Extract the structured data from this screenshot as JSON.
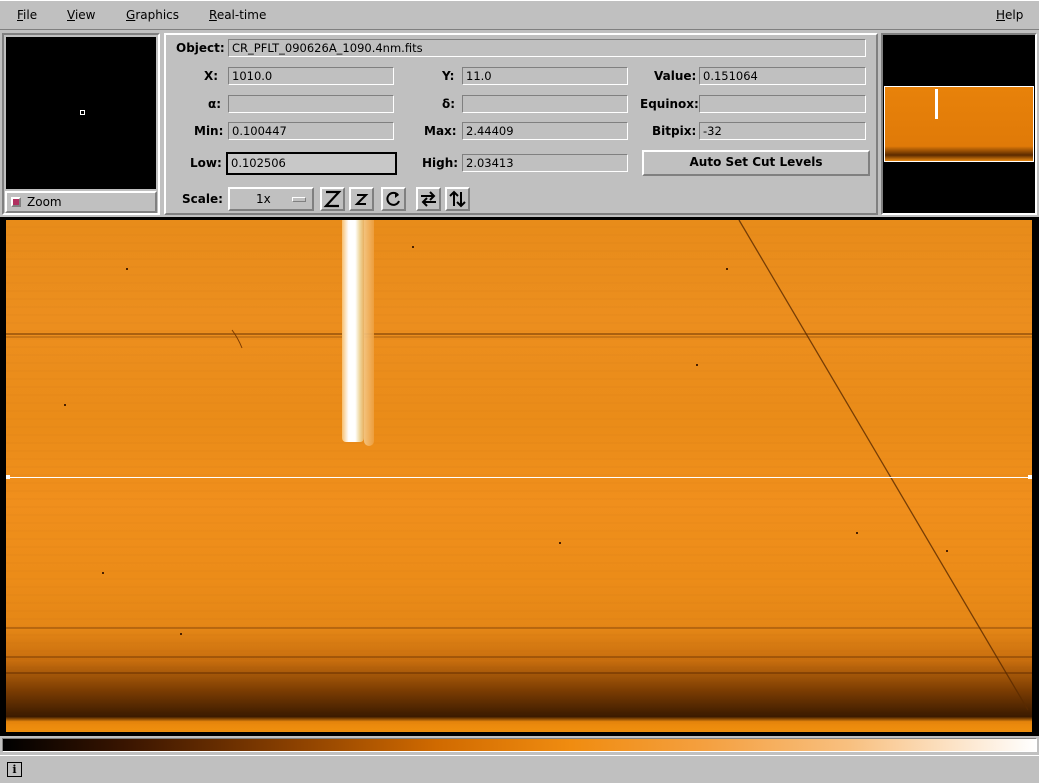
{
  "menubar": {
    "file": "File",
    "view": "View",
    "graphics": "Graphics",
    "realtime": "Real-time",
    "help": "Help"
  },
  "zoom": {
    "label": "Zoom",
    "checked": true
  },
  "info": {
    "object_label": "Object:",
    "object_value": "CR_PFLT_090626A_1090.4nm.fits",
    "x_label": "X:",
    "x_value": "1010.0",
    "y_label": "Y:",
    "y_value": "11.0",
    "value_label": "Value:",
    "value_value": "0.151064",
    "alpha_label": "α:",
    "alpha_value": "",
    "delta_label": "δ:",
    "delta_value": "",
    "equinox_label": "Equinox:",
    "equinox_value": "",
    "min_label": "Min:",
    "min_value": "0.100447",
    "max_label": "Max:",
    "max_value": "2.44409",
    "bitpix_label": "Bitpix:",
    "bitpix_value": "-32",
    "low_label": "Low:",
    "low_value": "0.102506",
    "high_label": "High:",
    "high_value": "2.03413",
    "auto_cut_label": "Auto Set Cut Levels",
    "scale_label": "Scale:",
    "scale_value": "1x"
  },
  "toolbar_icons": [
    "zoom-in-icon",
    "zoom-out-icon",
    "rotate-icon",
    "flip-x-icon",
    "flip-y-icon"
  ],
  "colors": {
    "accent": "#e88c1a",
    "panel": "#c0c0c0"
  }
}
